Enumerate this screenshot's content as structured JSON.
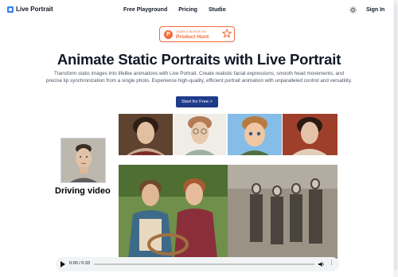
{
  "nav": {
    "logo_text": "Live Portrait",
    "links": [
      "Free Playground",
      "Pricing",
      "Studio"
    ],
    "sign_in": "Sign In"
  },
  "badge": {
    "top": "LEARN & REVIEW ON",
    "name": "Product Hunt",
    "icon_letter": "P",
    "color": "#f26b3a"
  },
  "hero": {
    "title": "Animate Static Portraits with Live Portrait",
    "subtitle_line1": "Transform static images into lifelike animations with Live Portrait. Create realistic facial expressions, smooth head movements, and",
    "subtitle_line2": "precise lip synchronization from a single photo. Experience high-quality, efficient portrait animation with unparalleled control and versatility.",
    "cta": "Start for Free >"
  },
  "demo": {
    "driving_label": "Driving video",
    "video_time": "0:00 / 0:33"
  },
  "colors": {
    "accent": "#1e3a8a",
    "logo": "#3b82f6"
  }
}
